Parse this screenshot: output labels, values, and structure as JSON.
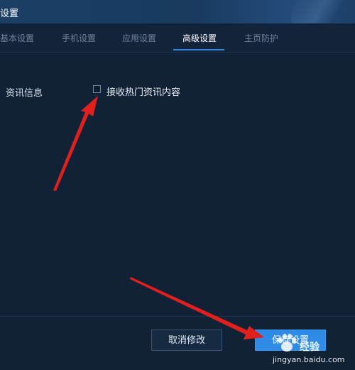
{
  "window": {
    "title": "设置"
  },
  "tabs": [
    {
      "label": "基本设置",
      "active": false
    },
    {
      "label": "手机设置",
      "active": false
    },
    {
      "label": "应用设置",
      "active": false
    },
    {
      "label": "高级设置",
      "active": true
    },
    {
      "label": "主页防护",
      "active": false
    }
  ],
  "settings": {
    "section_label": "资讯信息",
    "option_label": "接收热门资讯内容",
    "option_checked": false
  },
  "footer": {
    "cancel_label": "取消修改",
    "save_label": "保存设置"
  },
  "watermark": {
    "brand": "经验",
    "url": "jingyan.baidu.com"
  },
  "colors": {
    "background": "#112136",
    "accent": "#2f8be6",
    "annotation_arrow": "#e0201c"
  }
}
